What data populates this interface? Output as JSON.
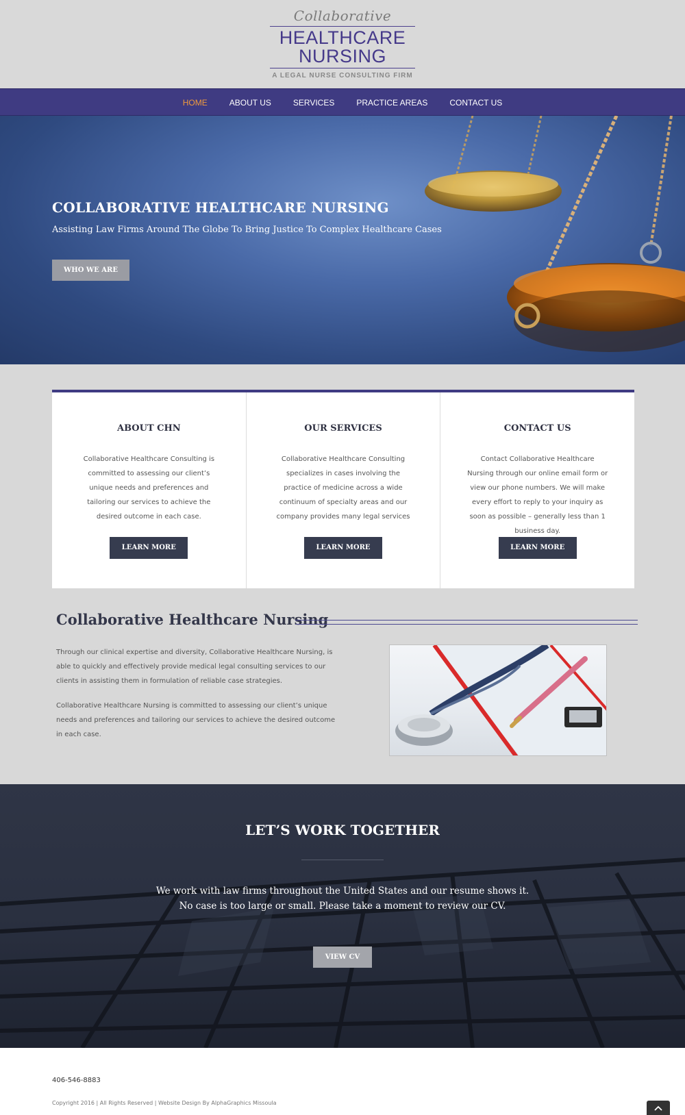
{
  "logo": {
    "script": "Collaborative",
    "line1": "HEALTHCARE",
    "line2": "NURSING",
    "tagline": "A LEGAL NURSE CONSULTING FIRM"
  },
  "nav": {
    "items": [
      {
        "label": "HOME",
        "active": true
      },
      {
        "label": "ABOUT US",
        "active": false
      },
      {
        "label": "SERVICES",
        "active": false
      },
      {
        "label": "PRACTICE AREAS",
        "active": false
      },
      {
        "label": "CONTACT US",
        "active": false
      }
    ]
  },
  "hero": {
    "title": "COLLABORATIVE HEALTHCARE NURSING",
    "subtitle": "Assisting Law Firms Around The Globe To Bring Justice To Complex Healthcare Cases",
    "button": "WHO WE ARE"
  },
  "cards": [
    {
      "title": "ABOUT CHN",
      "text": "Collaborative Healthcare Consulting is committed to assessing our client’s unique needs and preferences and tailoring our services to achieve the desired outcome in each case.",
      "button": "LEARN MORE"
    },
    {
      "title": "OUR SERVICES",
      "text": "Collaborative Healthcare Consulting specializes in cases involving the practice of medicine across a wide continuum of specialty areas and our company provides many legal services",
      "button": "LEARN MORE"
    },
    {
      "title": "CONTACT US",
      "text": "Contact Collaborative Healthcare Nursing through our online email form or view our phone numbers.  We will make every effort to reply to your inquiry as soon as possible – generally less than 1 business day.",
      "button": "LEARN MORE"
    }
  ],
  "about": {
    "title": "Collaborative Healthcare Nursing",
    "paragraph1": "Through our clinical expertise and diversity, Collaborative Healthcare Nursing, is able to quickly and effectively provide medical legal consulting services to our clients in assisting them in formulation of reliable case strategies.",
    "paragraph2": "Collaborative Healthcare Nursing is committed to assessing our client’s unique needs and preferences and tailoring our services to achieve the desired outcome in each case."
  },
  "work": {
    "title": "LET’S WORK TOGETHER",
    "text": "We work with law firms throughout the United States and our resume shows it.  No case is too large or small.   Please take a moment to review our CV.",
    "button": "VIEW CV"
  },
  "footer": {
    "phone": "406-546-8883",
    "copyright": "Copyright 2016 |  All Rights Reserved  |  Website Design By AlphaGraphics Missoula"
  },
  "colors": {
    "nav_bg": "#3f3b82",
    "nav_active": "#f09a3e",
    "brand_purple": "#45398a",
    "card_button": "#363c4f"
  }
}
